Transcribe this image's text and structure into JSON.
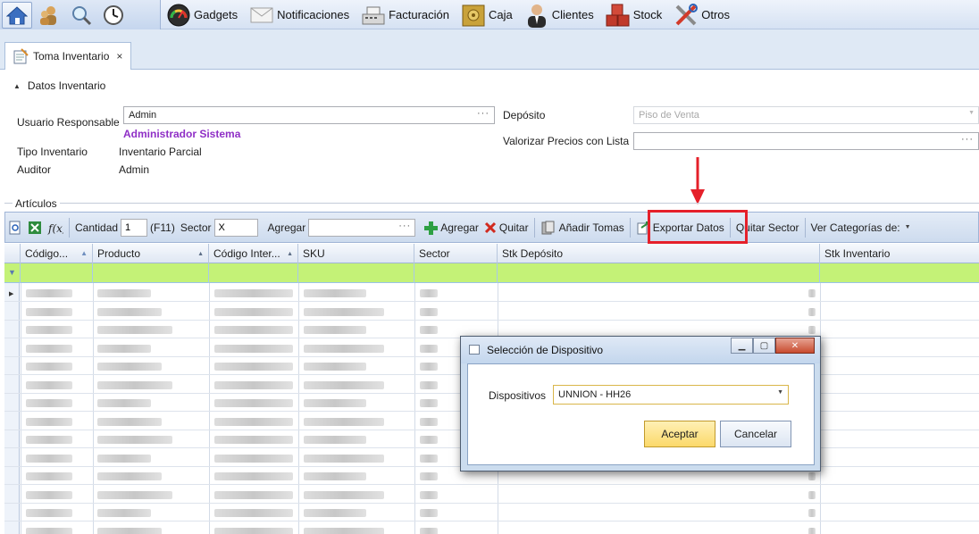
{
  "menu": {
    "items": [
      {
        "label": "Gadgets",
        "icon": "speedometer-icon"
      },
      {
        "label": "Notificaciones",
        "icon": "envelope-icon"
      },
      {
        "label": "Facturación",
        "icon": "cash-register-icon"
      },
      {
        "label": "Caja",
        "icon": "safe-icon"
      },
      {
        "label": "Clientes",
        "icon": "person-icon"
      },
      {
        "label": "Stock",
        "icon": "boxes-icon"
      },
      {
        "label": "Otros",
        "icon": "tools-icon"
      }
    ]
  },
  "tab": {
    "label": "Toma Inventario",
    "close": "×"
  },
  "form": {
    "section_title": "Datos Inventario",
    "usuario_label": "Usuario Responsable",
    "usuario_value": "Admin",
    "usuario_name": "Administrador Sistema",
    "tipo_label": "Tipo Inventario",
    "tipo_value": "Inventario Parcial",
    "auditor_label": "Auditor",
    "auditor_value": "Admin",
    "deposito_label": "Depósito",
    "deposito_value": "Piso de Venta",
    "valorizar_label": "Valorizar Precios con Lista",
    "valorizar_value": "",
    "dots": "···"
  },
  "articulos": {
    "title": "Artículos",
    "toolbar": {
      "cantidad_label": "Cantidad",
      "cantidad_value": "1",
      "f11_label": "(F11)",
      "sector_label": "Sector",
      "sector_value": "X",
      "agregar_label": "Agregar",
      "agregar_value": "",
      "agregar_button": "Agregar",
      "quitar_button": "Quitar",
      "anadir_tomas": "Añadir Tomas",
      "exportar_datos": "Exportar Datos",
      "quitar_sector": "Quitar Sector",
      "ver_categorias": "Ver Categorías de:"
    },
    "columns": [
      "Código...",
      "Producto",
      "Código Inter...",
      "SKU",
      "Sector",
      "Stk Depósito",
      "Stk Inventario"
    ]
  },
  "dialog": {
    "title": "Selección de Dispositivo",
    "dispositivos_label": "Dispositivos",
    "dispositivos_value": "UNNION - HH26",
    "ok": "Aceptar",
    "cancel": "Cancelar"
  },
  "colors": {
    "filter_row": "#c4f277",
    "highlight": "#e5202a",
    "usuario_name": "#8f2fc6"
  }
}
